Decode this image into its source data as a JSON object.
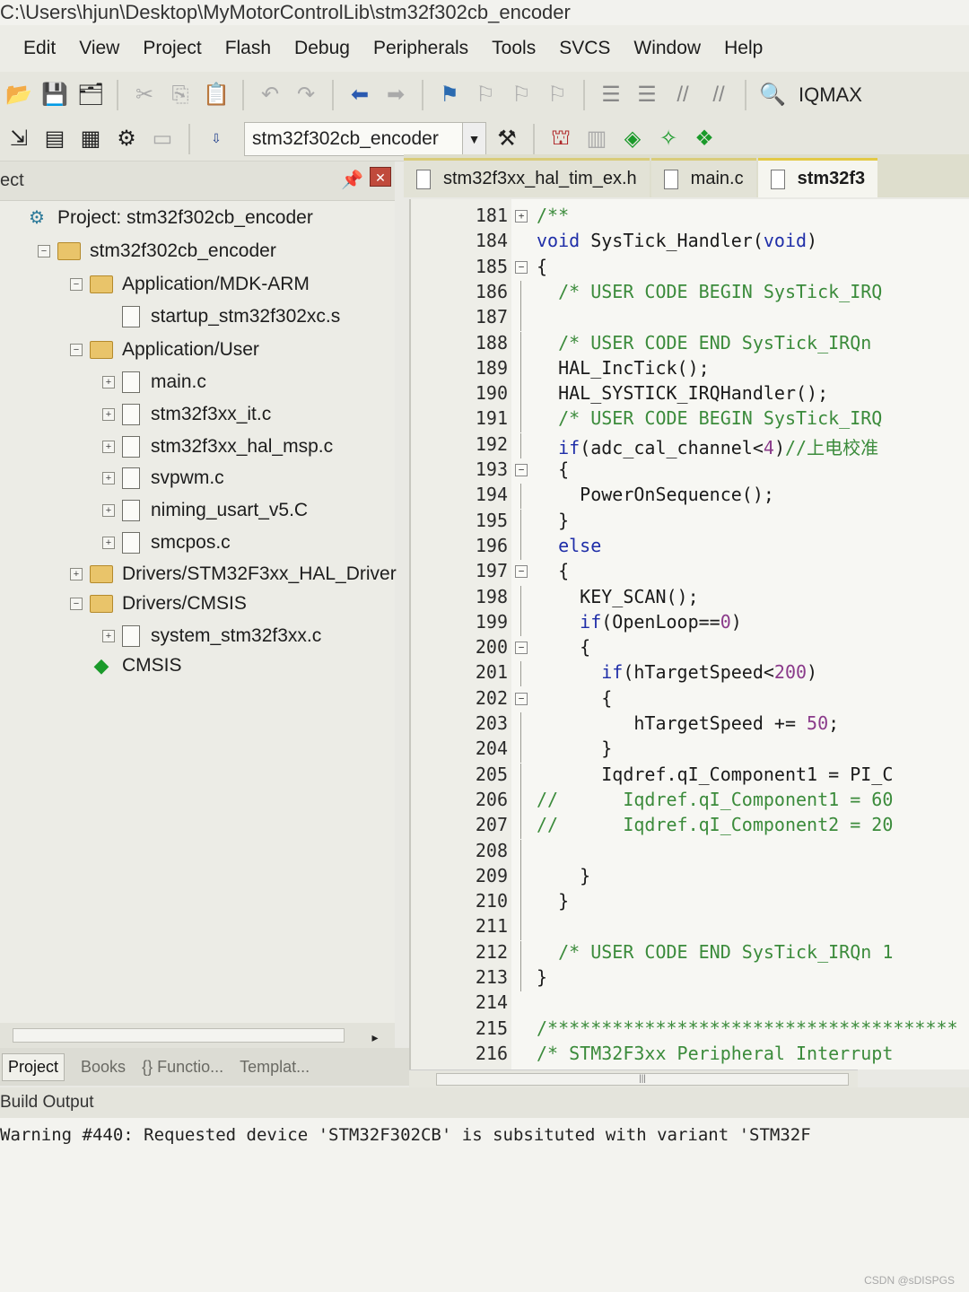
{
  "window": {
    "title": "C:\\Users\\hjun\\Desktop\\MyMotorControlLib\\stm32f302cb_encoder"
  },
  "menu": [
    "Edit",
    "View",
    "Project",
    "Flash",
    "Debug",
    "Peripherals",
    "Tools",
    "SVCS",
    "Window",
    "Help"
  ],
  "toolbar": {
    "iqmax_label": "IQMAX",
    "target_value": "stm32f302cb_encoder"
  },
  "project_panel": {
    "header_label": "ect",
    "tree": [
      {
        "label": "Project: stm32f302cb_encoder",
        "icon": "gear-icon",
        "indent": 0,
        "expander": ""
      },
      {
        "label": "stm32f302cb_encoder",
        "icon": "folder-icon",
        "indent": 1,
        "expander": "−"
      },
      {
        "label": "Application/MDK-ARM",
        "icon": "folder-icon",
        "indent": 2,
        "expander": "−"
      },
      {
        "label": "startup_stm32f302xc.s",
        "icon": "file-icon",
        "indent": 3,
        "expander": ""
      },
      {
        "label": "Application/User",
        "icon": "folder-icon",
        "indent": 2,
        "expander": "−"
      },
      {
        "label": "main.c",
        "icon": "file-icon",
        "indent": 3,
        "expander": "+"
      },
      {
        "label": "stm32f3xx_it.c",
        "icon": "file-icon",
        "indent": 3,
        "expander": "+"
      },
      {
        "label": "stm32f3xx_hal_msp.c",
        "icon": "file-icon",
        "indent": 3,
        "expander": "+"
      },
      {
        "label": "svpwm.c",
        "icon": "file-icon",
        "indent": 3,
        "expander": "+"
      },
      {
        "label": "niming_usart_v5.C",
        "icon": "file-icon",
        "indent": 3,
        "expander": "+"
      },
      {
        "label": "smcpos.c",
        "icon": "file-icon",
        "indent": 3,
        "expander": "+"
      },
      {
        "label": "Drivers/STM32F3xx_HAL_Driver",
        "icon": "folder-icon",
        "indent": 2,
        "expander": "+"
      },
      {
        "label": "Drivers/CMSIS",
        "icon": "folder-icon",
        "indent": 2,
        "expander": "−"
      },
      {
        "label": "system_stm32f3xx.c",
        "icon": "file-icon",
        "indent": 3,
        "expander": "+"
      },
      {
        "label": "CMSIS",
        "icon": "diamond-icon",
        "indent": 2,
        "expander": ""
      }
    ]
  },
  "bottom_tabs": [
    {
      "label": "Project",
      "active": true
    },
    {
      "label": "Books",
      "active": false
    },
    {
      "label": "{} Functio...",
      "active": false
    },
    {
      "label": "Templat...",
      "active": false
    }
  ],
  "editor_tabs": [
    {
      "label": "stm32f3xx_hal_tim_ex.h",
      "active": false
    },
    {
      "label": "main.c",
      "active": false
    },
    {
      "label": "stm32f3",
      "active": true
    }
  ],
  "code_lines": [
    {
      "n": "181",
      "fold": "+",
      "text": "/**"
    },
    {
      "n": "184",
      "fold": "",
      "text": "void SysTick_Handler(void)"
    },
    {
      "n": "185",
      "fold": "−",
      "text": "{"
    },
    {
      "n": "186",
      "fold": "|",
      "text": "  /* USER CODE BEGIN SysTick_IRQ"
    },
    {
      "n": "187",
      "fold": "|",
      "text": ""
    },
    {
      "n": "188",
      "fold": "|",
      "text": "  /* USER CODE END SysTick_IRQn"
    },
    {
      "n": "189",
      "fold": "|",
      "text": "  HAL_IncTick();"
    },
    {
      "n": "190",
      "fold": "|",
      "text": "  HAL_SYSTICK_IRQHandler();"
    },
    {
      "n": "191",
      "fold": "|",
      "text": "  /* USER CODE BEGIN SysTick_IRQ"
    },
    {
      "n": "192",
      "fold": "|",
      "text": "  if(adc_cal_channel<4)//上电校准"
    },
    {
      "n": "193",
      "fold": "−",
      "text": "  {"
    },
    {
      "n": "194",
      "fold": "|",
      "text": "    PowerOnSequence();"
    },
    {
      "n": "195",
      "fold": "-",
      "text": "  }"
    },
    {
      "n": "196",
      "fold": "|",
      "text": "  else"
    },
    {
      "n": "197",
      "fold": "−",
      "text": "  {"
    },
    {
      "n": "198",
      "fold": "|",
      "text": "    KEY_SCAN();"
    },
    {
      "n": "199",
      "fold": "|",
      "text": "    if(OpenLoop==0)"
    },
    {
      "n": "200",
      "fold": "−",
      "text": "    {"
    },
    {
      "n": "201",
      "fold": "|",
      "text": "      if(hTargetSpeed<200)"
    },
    {
      "n": "202",
      "fold": "−",
      "text": "      {"
    },
    {
      "n": "203",
      "fold": "|",
      "text": "         hTargetSpeed += 50;"
    },
    {
      "n": "204",
      "fold": "-",
      "text": "      }"
    },
    {
      "n": "205",
      "fold": "|",
      "text": "      Iqdref.qI_Component1 = PI_C"
    },
    {
      "n": "206",
      "fold": "|",
      "text": "//      Iqdref.qI_Component1 = 60"
    },
    {
      "n": "207",
      "fold": "|",
      "text": "//      Iqdref.qI_Component2 = 20"
    },
    {
      "n": "208",
      "fold": "|",
      "text": ""
    },
    {
      "n": "209",
      "fold": "-",
      "text": "    }"
    },
    {
      "n": "210",
      "fold": "-",
      "text": "  }"
    },
    {
      "n": "211",
      "fold": "|",
      "text": ""
    },
    {
      "n": "212",
      "fold": "|",
      "text": "  /* USER CODE END SysTick_IRQn 1"
    },
    {
      "n": "213",
      "fold": "-",
      "text": "}"
    },
    {
      "n": "214",
      "fold": "",
      "text": ""
    },
    {
      "n": "215",
      "fold": "",
      "text": "/**************************************"
    },
    {
      "n": "216",
      "fold": "",
      "text": "/* STM32F3xx Peripheral Interrupt"
    }
  ],
  "build": {
    "label": "Build Output",
    "message": "Warning #440: Requested device 'STM32F302CB' is subsituted with variant 'STM32F"
  },
  "watermark": "CSDN @sDISPGS"
}
